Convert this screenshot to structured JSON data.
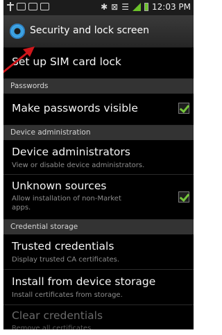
{
  "status_bar": {
    "icons": [
      "usb-icon",
      "mail-icon",
      "image-icon",
      "message-icon",
      "bluetooth-icon",
      "no-sound-icon",
      "wifi-icon",
      "signal-icon",
      "battery-icon"
    ],
    "time": "12:03 PM",
    "accent": "#6bc12a"
  },
  "header": {
    "title": "Security and lock screen",
    "icon": "gear-icon"
  },
  "items": {
    "sim_lock": {
      "label": "Set up SIM card lock"
    },
    "passwords_visible": {
      "label": "Make passwords visible",
      "checked": true
    },
    "device_admins": {
      "label": "Device administrators",
      "sub": "View or disable device administrators."
    },
    "unknown_sources": {
      "label": "Unknown sources",
      "sub1": "Allow installation of non-Market",
      "sub2": "apps.",
      "checked": true
    },
    "trusted_creds": {
      "label": "Trusted credentials",
      "sub": "Display trusted CA certificates."
    },
    "install_storage": {
      "label": "Install from device storage",
      "sub": "Install certificates from storage."
    },
    "clear_creds": {
      "label": "Clear credentials",
      "sub": "Remove all certificates.",
      "enabled": false
    }
  },
  "sections": {
    "passwords": "Passwords",
    "device_admin": "Device administration",
    "credential_storage": "Credential storage"
  },
  "colors": {
    "check": "#74c43a",
    "arrow": "#d0161b",
    "section_bg": "#333333"
  }
}
